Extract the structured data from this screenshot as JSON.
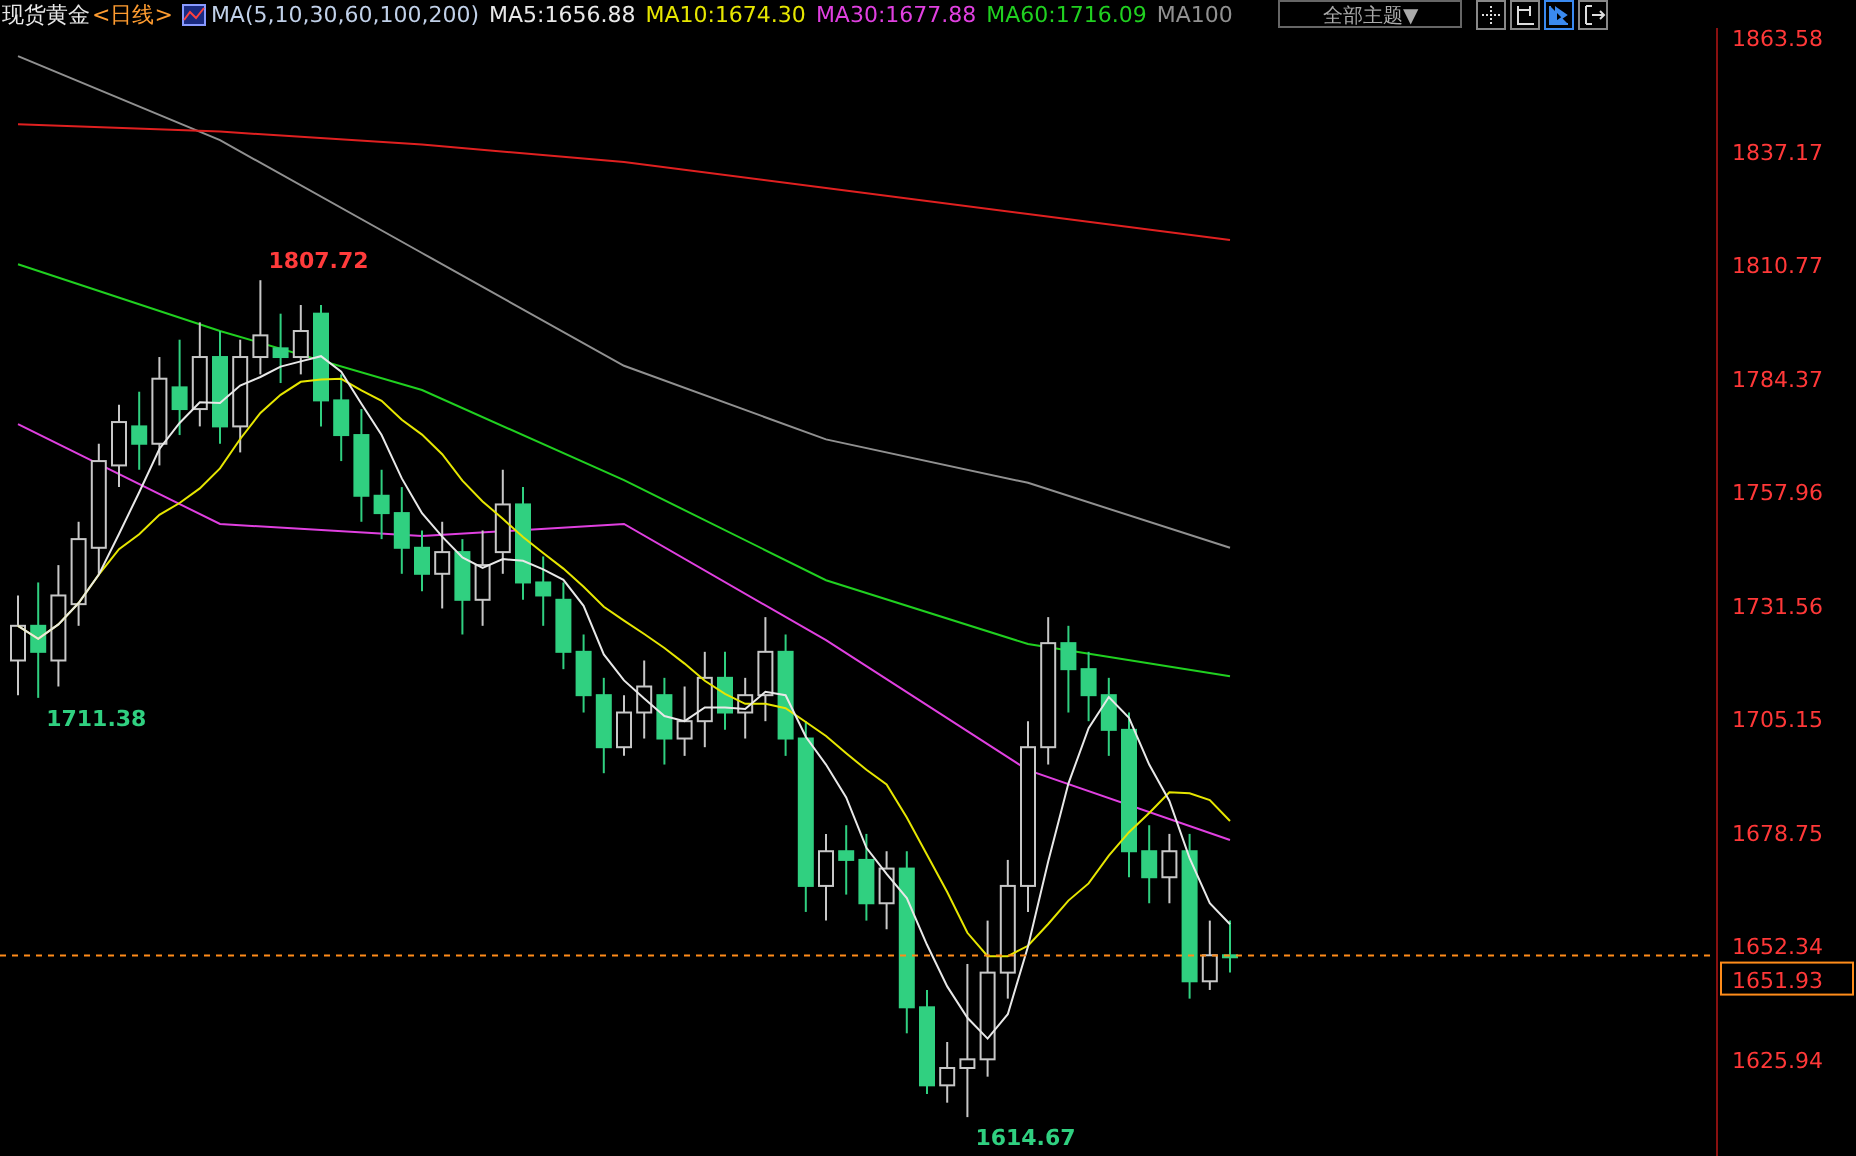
{
  "header": {
    "title": "现货黄金",
    "period": "<日线>",
    "indicator": "MA(5,10,30,60,100,200)",
    "legend": [
      {
        "label": "MA5:1656.88",
        "color": "#e8e8e8"
      },
      {
        "label": "MA10:1674.30",
        "color": "#e6e600"
      },
      {
        "label": "MA30:1677.88",
        "color": "#e040e0"
      },
      {
        "label": "MA60:1716.09",
        "color": "#20d020"
      },
      {
        "label": "MA100",
        "color": "#909090"
      }
    ],
    "theme_dropdown": "全部主题▼"
  },
  "price_axis": [
    "1863.58",
    "1837.17",
    "1810.77",
    "1784.37",
    "1757.96",
    "1731.56",
    "1705.15",
    "1678.75",
    "1652.34",
    "1625.94"
  ],
  "extreme_labels": [
    {
      "kind": "high",
      "label": "1807.72"
    },
    {
      "kind": "low",
      "label": "1711.38"
    },
    {
      "kind": "low",
      "label": "1614.67"
    }
  ],
  "current_price_label": "1651.93"
}
